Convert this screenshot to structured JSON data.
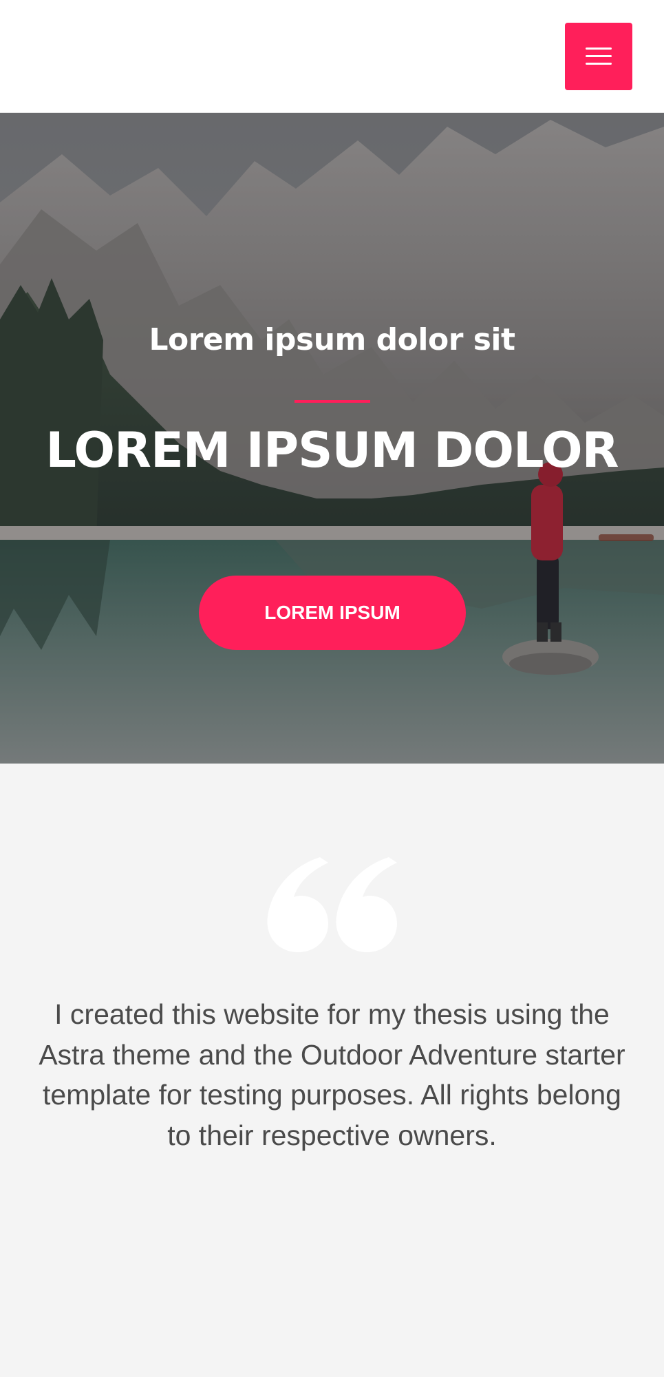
{
  "header": {
    "menu_icon": "hamburger-menu-icon",
    "accent_color": "#ff1f5a"
  },
  "hero": {
    "subtitle": "Lorem ipsum dolor sit",
    "title": "LOREM IPSUM DOLOR",
    "button_label": "LOREM IPSUM",
    "background": "mountain-lake-photo"
  },
  "testimonial": {
    "quote_icon": "quote-icon",
    "text": "I created this website for my thesis using the Astra theme and the Outdoor Adventure starter template for testing purposes. All rights belong to their respective owners."
  }
}
